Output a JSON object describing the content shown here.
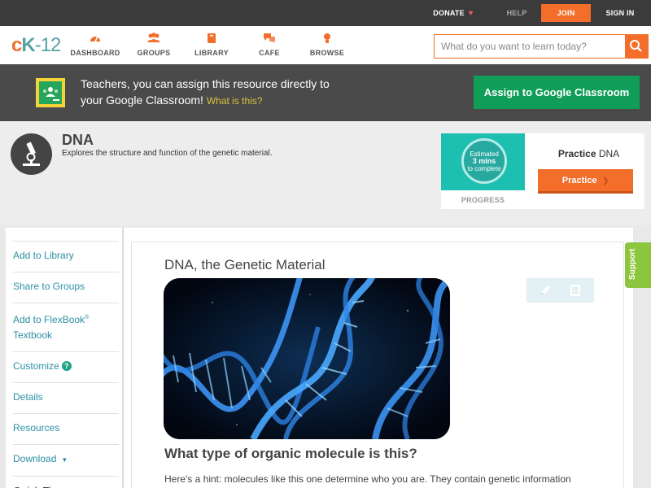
{
  "topbar": {
    "donate": "DONATE",
    "help": "HELP",
    "join": "JOIN",
    "signin": "SIGN IN"
  },
  "logo": {
    "c": "c",
    "k": "K",
    "num": "-12"
  },
  "nav": {
    "items": [
      {
        "label": "DASHBOARD",
        "icon": "dashboard-icon"
      },
      {
        "label": "GROUPS",
        "icon": "groups-icon"
      },
      {
        "label": "LIBRARY",
        "icon": "library-icon"
      },
      {
        "label": "CAFE",
        "icon": "cafe-icon"
      },
      {
        "label": "BROWSE",
        "icon": "browse-icon"
      }
    ]
  },
  "search": {
    "placeholder": "What do you want to learn today?",
    "value": ""
  },
  "classroom": {
    "text_line1": "Teachers, you can assign this resource directly to",
    "text_line2": "your Google Classroom!",
    "what_is": "What is this?",
    "button": "Assign to Google Classroom"
  },
  "concept": {
    "title": "DNA",
    "description": "Explores the structure and function of the genetic material."
  },
  "practice": {
    "estimate_line1": "Estimated",
    "estimate_line2": "3 mins",
    "estimate_line3": "to complete",
    "progress_label": "PROGRESS",
    "label_bold": "Practice",
    "label_rest": " DNA",
    "button": "Practice"
  },
  "sidebar": {
    "add_library": "Add to Library",
    "share_groups": "Share to Groups",
    "add_flexbook": "Add to FlexBook",
    "reg_mark": "®",
    "textbook": "Textbook",
    "customize": "Customize",
    "help_mark": "?",
    "details": "Details",
    "resources": "Resources",
    "download": "Download",
    "quick_tips": "Quick Tips"
  },
  "article": {
    "title": "DNA, the Genetic Material",
    "question": "What type of organic molecule is this?",
    "hint": "Here's a hint: molecules like this one determine who you are. They contain genetic information"
  },
  "support": {
    "label": "Support"
  },
  "colors": {
    "brand_orange": "#f26e2a",
    "brand_teal": "#56a3a6",
    "google_green": "#0f9d58",
    "link_blue": "#2b8fa5",
    "support_green": "#8cc63e"
  }
}
